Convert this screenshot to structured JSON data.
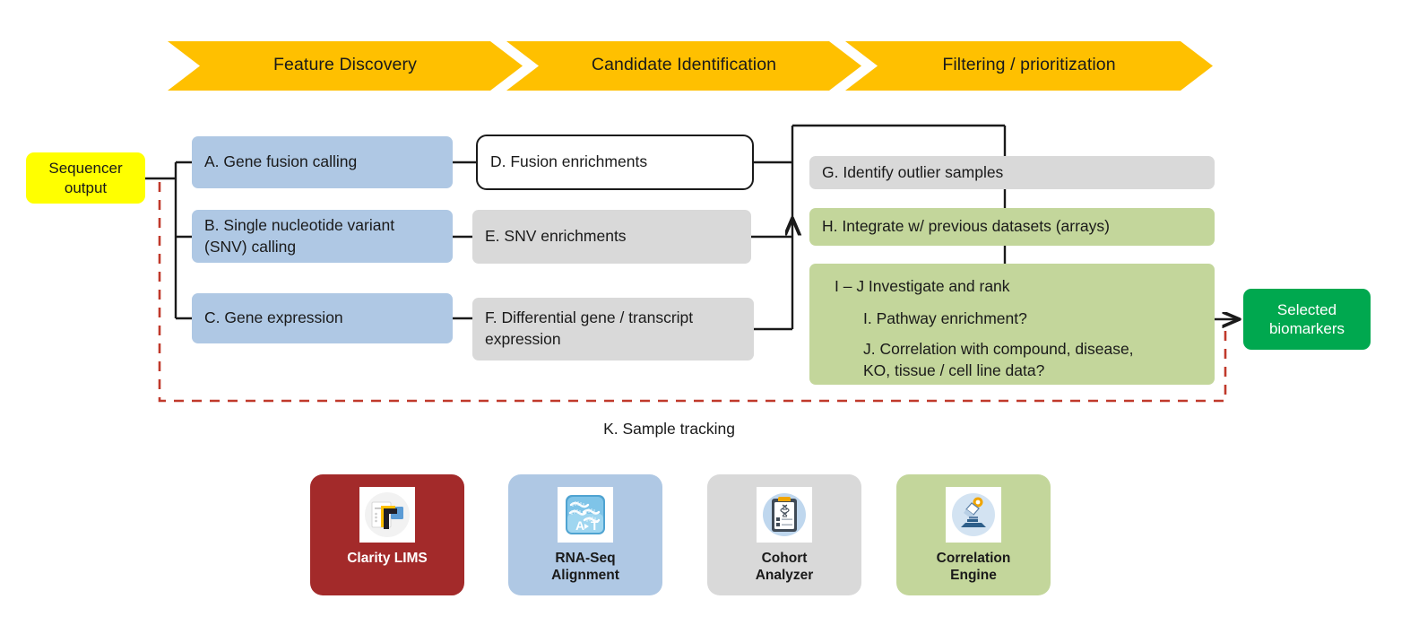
{
  "phases": [
    {
      "label": "Feature Discovery"
    },
    {
      "label": "Candidate Identification"
    },
    {
      "label": "Filtering / prioritization"
    }
  ],
  "input_node": {
    "label": "Sequencer\noutput",
    "color": "#FFFF00"
  },
  "output_node": {
    "label": "Selected\nbiomarkers",
    "color": "#00A84F"
  },
  "feature_discovery_steps": [
    {
      "id": "A",
      "label": "A. Gene fusion calling",
      "color": "#AFC8E4"
    },
    {
      "id": "B",
      "label": "B. Single nucleotide variant\n(SNV)  calling",
      "color": "#AFC8E4"
    },
    {
      "id": "C",
      "label": "C. Gene expression",
      "color": "#AFC8E4"
    }
  ],
  "candidate_identification_steps": [
    {
      "id": "D",
      "label": "D.  Fusion enrichments",
      "color": "#FFFFFF"
    },
    {
      "id": "E",
      "label": "E. SNV enrichments",
      "color": "#D9D9D9"
    },
    {
      "id": "F",
      "label": "F.  Differential gene / transcript\nexpression",
      "color": "#D9D9D9"
    }
  ],
  "filtering_steps": [
    {
      "id": "G",
      "label": "G. Identify outlier samples",
      "color": "#D9D9D9"
    },
    {
      "id": "H",
      "label": "H. Integrate w/ previous datasets (arrays)",
      "color": "#C3D69B"
    }
  ],
  "investigate_box": {
    "color": "#C3D69B",
    "heading": "I – J   Investigate and rank",
    "items": [
      "I. Pathway enrichment?",
      "J. Correlation with compound, disease,\nKO, tissue / cell line data?"
    ]
  },
  "tracking_label": "K. Sample tracking",
  "products": [
    {
      "name": "Clarity LIMS",
      "label": "Clarity LIMS",
      "bg": "#A32A2A",
      "text_color": "#FFFFFF",
      "icon": "lims-document-icon"
    },
    {
      "name": "RNA-Seq Alignment",
      "label": "RNA-Seq\nAlignment",
      "bg": "#AFC8E4",
      "text_color": "#1A1A1A",
      "icon": "rnaseq-alignment-icon"
    },
    {
      "name": "Cohort Analyzer",
      "label": "Cohort\nAnalyzer",
      "bg": "#D9D9D9",
      "text_color": "#1A1A1A",
      "icon": "clipboard-cohort-icon"
    },
    {
      "name": "Correlation Engine",
      "label": "Correlation\nEngine",
      "bg": "#C3D69B",
      "text_color": "#1A1A1A",
      "icon": "microscope-icon"
    }
  ],
  "colors": {
    "banner": "#FFC000",
    "blue": "#AFC8E4",
    "grey": "#D9D9D9",
    "green": "#C3D69B",
    "yellow": "#FFFF00",
    "output_green": "#00A84F",
    "lims_red": "#A32A2A",
    "wire": "#1A1A1A",
    "feedback_dashed": "#C0392B"
  }
}
